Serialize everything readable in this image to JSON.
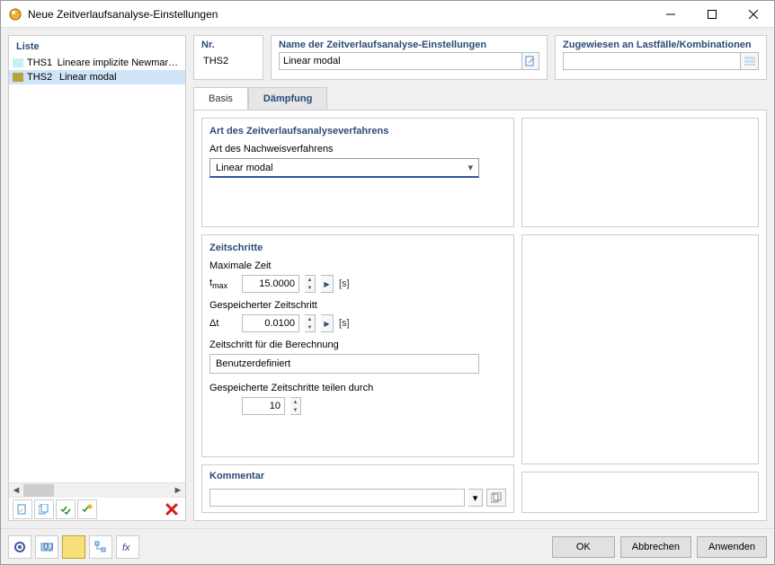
{
  "window": {
    "title": "Neue Zeitverlaufsanalyse-Einstellungen"
  },
  "list": {
    "heading": "Liste",
    "items": [
      {
        "code": "THS1",
        "label": "Lineare implizite Newmark-A...",
        "color": "#c7f0f0"
      },
      {
        "code": "THS2",
        "label": "Linear modal",
        "color": "#b4a636"
      }
    ]
  },
  "header": {
    "nr_label": "Nr.",
    "nr_value": "THS2",
    "name_label": "Name der Zeitverlaufsanalyse-Einstellungen",
    "name_value": "Linear modal",
    "assign_label": "Zugewiesen an Lastfälle/Kombinationen"
  },
  "tabs": {
    "tab1": "Basis",
    "tab2": "Dämpfung"
  },
  "method_group": {
    "title": "Art des Zeitverlaufsanalyseverfahrens",
    "label": "Art des Nachweisverfahrens",
    "value": "Linear modal"
  },
  "steps_group": {
    "title": "Zeitschritte",
    "tmax_label": "Maximale Zeit",
    "tmax_symbol": "t",
    "tmax_sub": "max",
    "tmax_value": "15.0000",
    "tmax_unit": "[s]",
    "dt_label": "Gespeicherter Zeitschritt",
    "dt_symbol": "Δt",
    "dt_value": "0.0100",
    "dt_unit": "[s]",
    "calc_label": "Zeitschritt für die Berechnung",
    "calc_value": "Benutzerdefiniert",
    "divide_label": "Gespeicherte Zeitschritte teilen durch",
    "divide_value": "10"
  },
  "comment_group": {
    "title": "Kommentar"
  },
  "footer": {
    "ok": "OK",
    "cancel": "Abbrechen",
    "apply": "Anwenden"
  }
}
